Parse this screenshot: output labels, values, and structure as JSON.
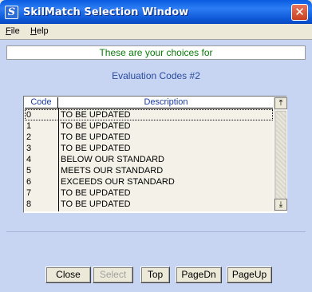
{
  "window": {
    "title": "SkilMatch Selection Window",
    "app_icon_letter": "S",
    "close_glyph": "✕"
  },
  "menu": [
    {
      "key": "F",
      "rest": "ile"
    },
    {
      "key": "H",
      "rest": "elp"
    }
  ],
  "header": {
    "text": "These are your choices for"
  },
  "subtitle": "Evaluation Codes #2",
  "table": {
    "columns": [
      "Code",
      "Description"
    ],
    "rows": [
      {
        "code": "0",
        "desc": "TO BE UPDATED"
      },
      {
        "code": "1",
        "desc": "TO BE UPDATED"
      },
      {
        "code": "2",
        "desc": "TO BE UPDATED"
      },
      {
        "code": "3",
        "desc": "TO BE UPDATED"
      },
      {
        "code": "4",
        "desc": "BELOW OUR STANDARD"
      },
      {
        "code": "5",
        "desc": "MEETS OUR STANDARD"
      },
      {
        "code": "6",
        "desc": "EXCEEDS OUR STANDARD"
      },
      {
        "code": "7",
        "desc": "TO BE UPDATED"
      },
      {
        "code": "8",
        "desc": "TO BE UPDATED"
      }
    ]
  },
  "buttons": {
    "close": "Close",
    "select": "Select",
    "top": "Top",
    "pagedn": "PageDn",
    "pageup": "PageUp"
  }
}
